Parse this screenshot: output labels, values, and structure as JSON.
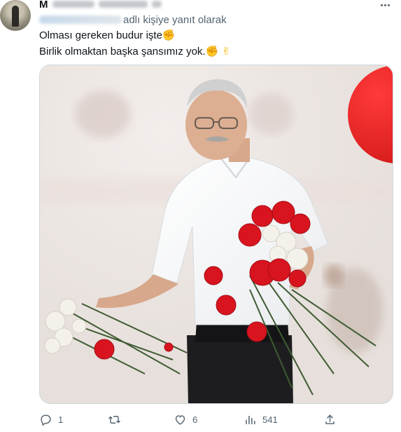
{
  "author": {
    "name": "M"
  },
  "reply": {
    "suffix": "adlı kişiye yanıt olarak"
  },
  "tweet": {
    "line1": "Olması gereken budur işte",
    "line1_emoji": "✊",
    "line2": "Birlik olmaktan başka şansımız yok.",
    "line2_emoji": "✊ ✌"
  },
  "metrics": {
    "replies": "1",
    "reposts": "",
    "likes": "6",
    "views": "541"
  },
  "icons": {
    "more": "more-icon",
    "reply": "reply-icon",
    "repost": "repost-icon",
    "like": "like-icon",
    "views": "views-icon",
    "share": "share-icon"
  },
  "colors": {
    "text": "#0f1419",
    "secondary": "#536471",
    "border": "#cfd9de"
  }
}
